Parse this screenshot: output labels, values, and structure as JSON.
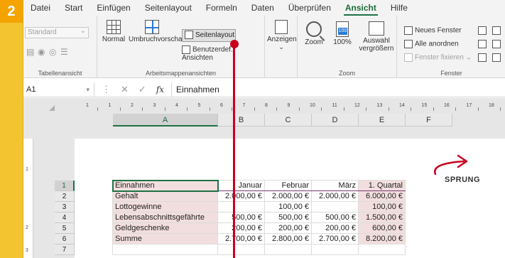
{
  "step_badge": "2",
  "menu": {
    "tabs": [
      "Datei",
      "Start",
      "Einfügen",
      "Seitenlayout",
      "Formeln",
      "Daten",
      "Überprüfen",
      "Ansicht",
      "Hilfe"
    ]
  },
  "ribbon": {
    "tabellenansicht": {
      "combo_value": "Standard",
      "label": "Tabellenansicht"
    },
    "arbeitsmappenansichten": {
      "normal": "Normal",
      "umbruchvorschau": "Umbruchvorschau",
      "seitenlayout": "Seitenlayout",
      "benutzerdef": "Benutzerdef. Ansichten",
      "label": "Arbeitsmappenansichten"
    },
    "anzeigen": {
      "label": "Anzeigen"
    },
    "zoom": {
      "zoom": "Zoom",
      "hundert": "100%",
      "hundert_icon": "100",
      "auswahl_line1": "Auswahl",
      "auswahl_line2": "vergrößern",
      "label": "Zoom"
    },
    "fenster": {
      "neues": "Neues Fenster",
      "alle": "Alle anordnen",
      "fixieren": "Fenster fixieren",
      "label": "Fenster"
    }
  },
  "formula_bar": {
    "name_box": "A1",
    "content": "Einnahmen"
  },
  "ruler_numbers": [
    "1",
    "1",
    "2",
    "3",
    "4",
    "5",
    "6",
    "7",
    "8",
    "9",
    "10",
    "11",
    "12",
    "13",
    "14",
    "15",
    "16",
    "17",
    "18"
  ],
  "vruler_numbers": [
    "1",
    "2",
    "3"
  ],
  "columns": [
    "A",
    "B",
    "C",
    "D",
    "E",
    "F"
  ],
  "rows": [
    "1",
    "2",
    "3",
    "4",
    "5",
    "6",
    "7"
  ],
  "table": [
    [
      "Einnahmen",
      "Januar",
      "Februar",
      "März",
      "1. Quartal",
      ""
    ],
    [
      "Gehalt",
      "2.000,00 €",
      "2.000,00 €",
      "2.000,00 €",
      "6.000,00 €",
      ""
    ],
    [
      "Lottogewinne",
      "",
      "100,00 €",
      "",
      "100,00 €",
      ""
    ],
    [
      "Lebensabschnittsgefährte",
      "500,00 €",
      "500,00 €",
      "500,00 €",
      "1.500,00 €",
      ""
    ],
    [
      "Geldgeschenke",
      "200,00 €",
      "200,00 €",
      "200,00 €",
      "600,00 €",
      ""
    ],
    [
      "Summe",
      "2.700,00 €",
      "2.800,00 €",
      "2.700,00 €",
      "8.200,00 €",
      ""
    ],
    [
      "",
      "",
      "",
      "",
      "",
      ""
    ]
  ],
  "annotation": {
    "text": "SPRUNG"
  },
  "colors": {
    "accent_green": "#1e7145",
    "marker_red": "#c8001e",
    "highlight_pink": "#f2dede",
    "badge_orange": "#f4a300"
  }
}
